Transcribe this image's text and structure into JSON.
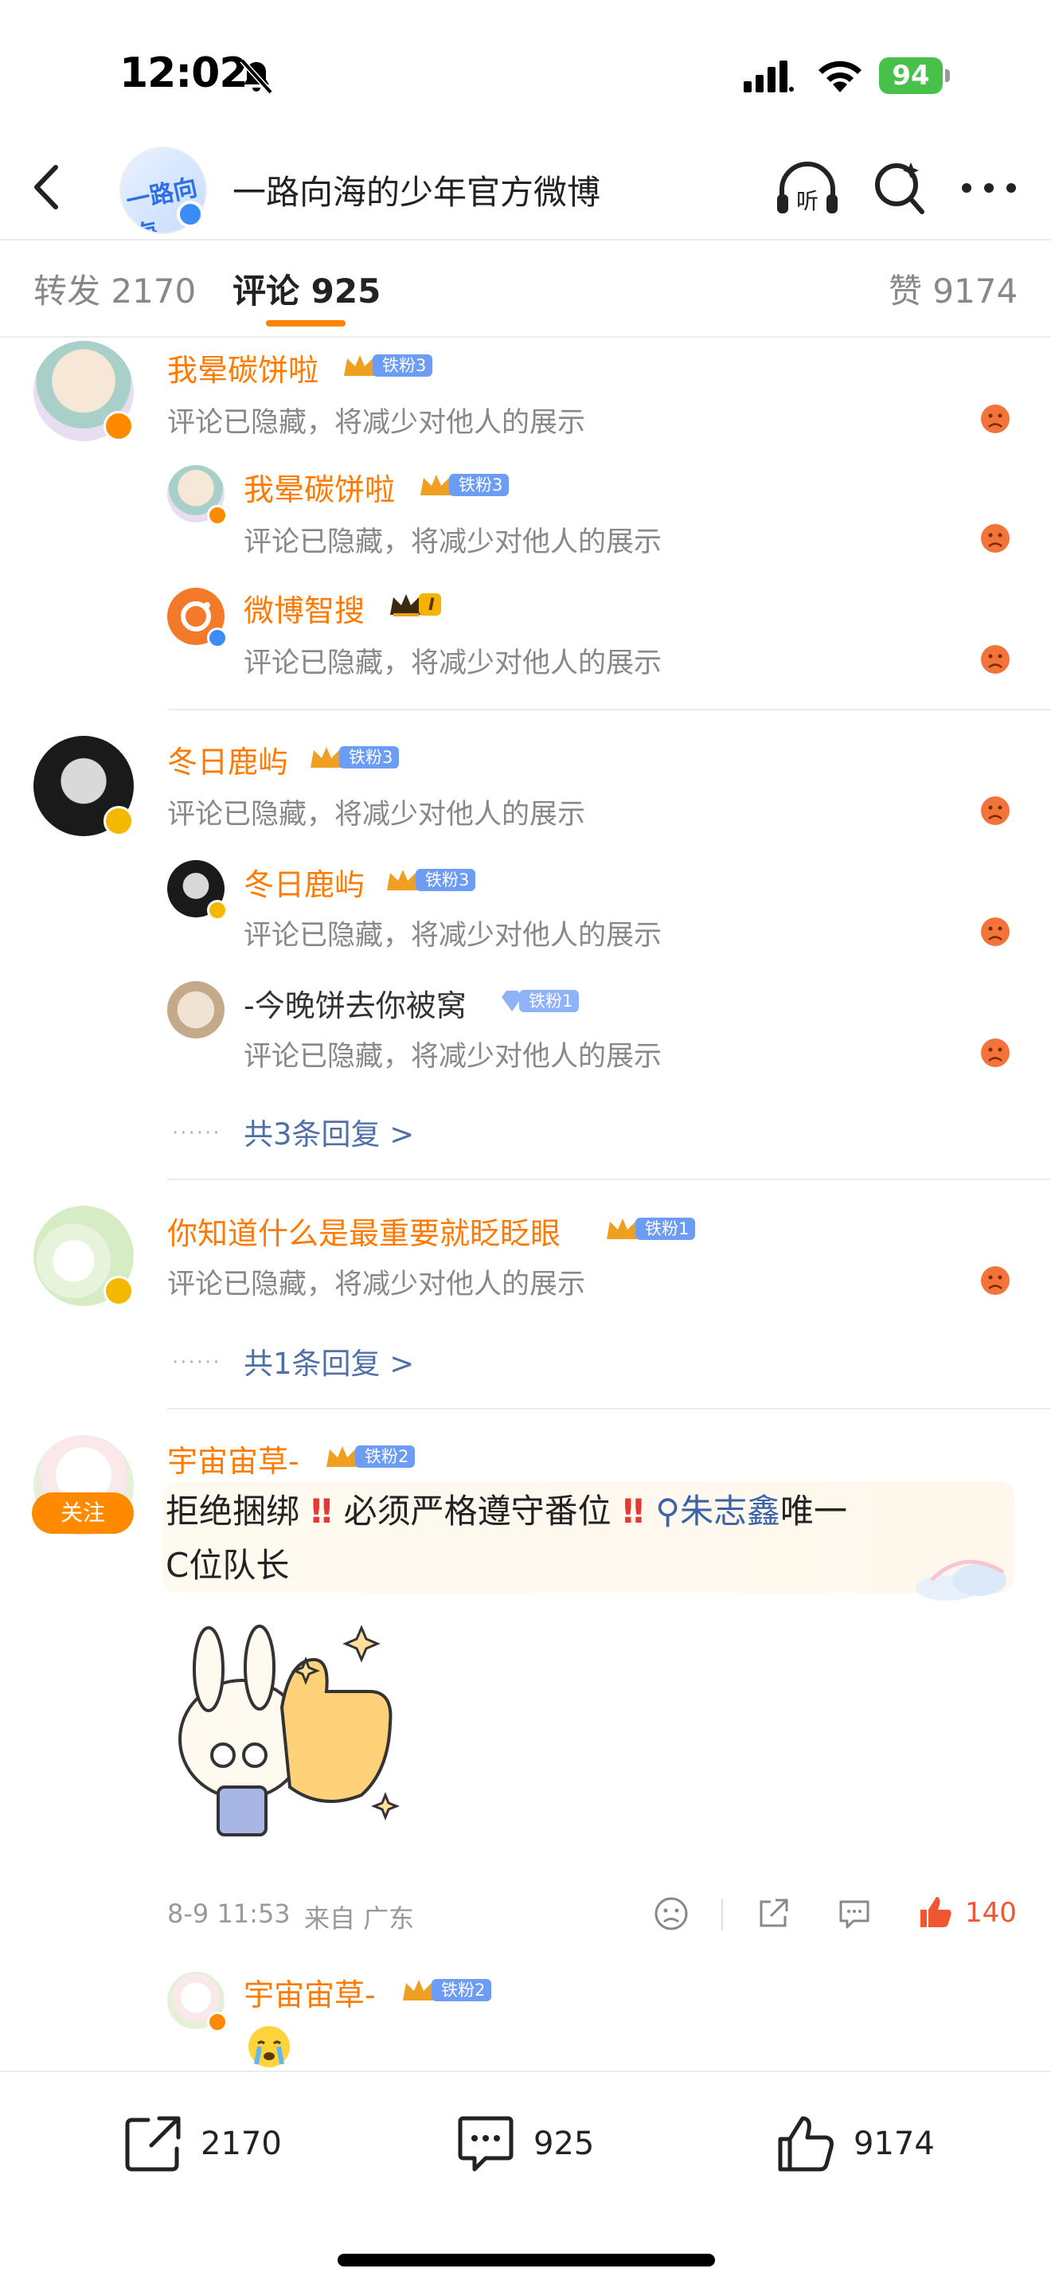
{
  "status_bar": {
    "time": "12:02",
    "battery": "94"
  },
  "header": {
    "title": "一路向海的少年官方微博",
    "logo_text": "一路向海"
  },
  "tabs": [
    {
      "label": "转发 2170"
    },
    {
      "label": "评论 925"
    },
    {
      "label": "赞 9174"
    }
  ],
  "hidden_message": "评论已隐藏，将减少对他人的展示",
  "comments": [
    {
      "user": "我晕碳饼啦",
      "badge": "铁粉3",
      "replies": [
        {
          "user": "我晕碳饼啦",
          "badge": "铁粉3"
        },
        {
          "user": "微博智搜",
          "badge": "I"
        }
      ]
    },
    {
      "user": "冬日鹿屿",
      "badge": "铁粉3",
      "replies": [
        {
          "user": "冬日鹿屿",
          "badge": "铁粉3"
        },
        {
          "user": "-今晚饼去你被窝",
          "badge": "铁粉1"
        }
      ],
      "more_replies": "共3条回复 >"
    },
    {
      "user": "你知道什么是最重要就眨眨眼",
      "badge": "铁粉1",
      "more_replies": "共1条回复 >"
    },
    {
      "user": "宇宙宙草-",
      "badge": "铁粉2",
      "follow_label": "关注",
      "text_part1": "拒绝捆绑",
      "text_part2": "必须严格遵守番位",
      "topic": "朱志鑫",
      "text_part3": "唯一",
      "text_line2": "C位队长",
      "time": "8-9 11:53",
      "source": "来自 广东",
      "likes": "140",
      "replies": [
        {
          "user": "宇宙宙草-",
          "badge": "铁粉2"
        }
      ]
    }
  ],
  "bottom_bar": {
    "repost": "2170",
    "comment": "925",
    "like": "9174"
  },
  "colors": {
    "accent": "#ff8200",
    "username": "#ff7a00",
    "link": "#4f6fa8",
    "like": "#f0562f"
  }
}
